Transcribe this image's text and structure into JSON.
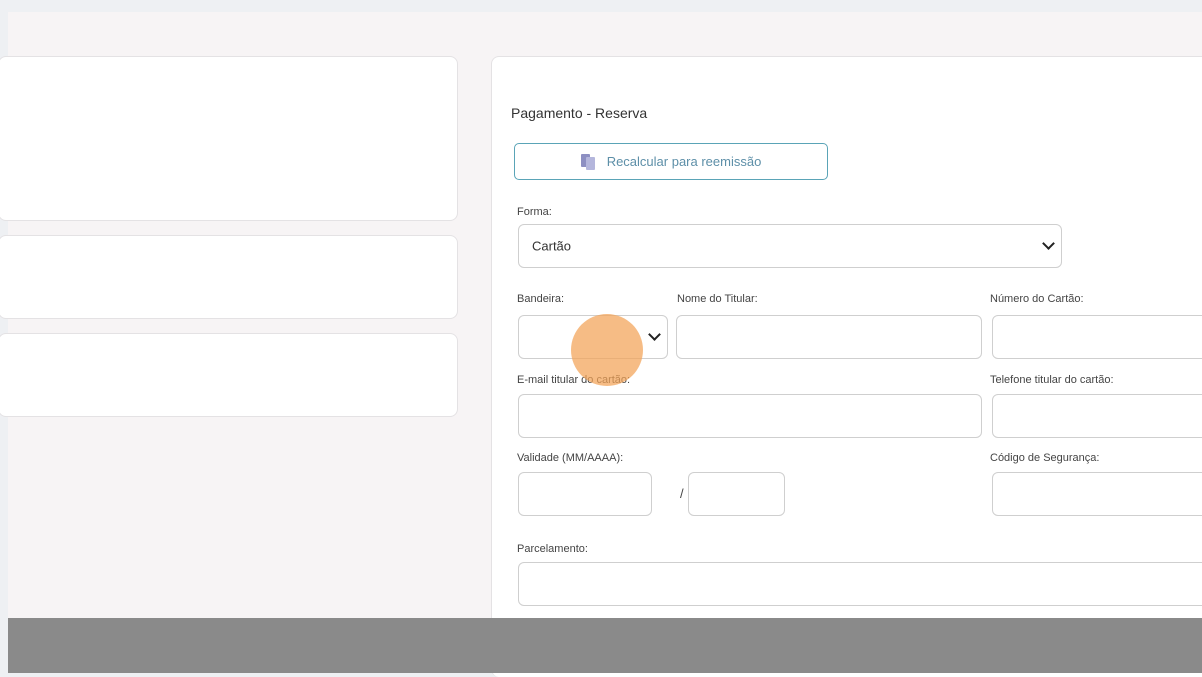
{
  "payment": {
    "title": "Pagamento - Reserva",
    "recalc_button": "Recalcular para reemissão",
    "forma": {
      "label": "Forma:",
      "value": "Cartão"
    },
    "bandeira": {
      "label": "Bandeira:",
      "value": ""
    },
    "nome_titular": {
      "label": "Nome do Titular:",
      "value": ""
    },
    "numero_cartao": {
      "label": "Número do Cartão:",
      "value": ""
    },
    "email_titular": {
      "label": "E-mail titular do cartão:",
      "value": ""
    },
    "telefone_titular": {
      "label": "Telefone titular do cartão:",
      "value": ""
    },
    "validade": {
      "label": "Validade (MM/AAAA):",
      "month": "",
      "separator": "/",
      "year": ""
    },
    "codigo_seguranca": {
      "label": "Código de Segurança:",
      "value": ""
    },
    "parcelamento": {
      "label": "Parcelamento:",
      "value": ""
    }
  },
  "colors": {
    "accent_border": "#5aa4b7",
    "cursor_highlight": "#f2a256",
    "footer": "#8a8a8a"
  },
  "icons": {
    "recalc": "documents-icon",
    "select": "chevron-down-icon"
  }
}
